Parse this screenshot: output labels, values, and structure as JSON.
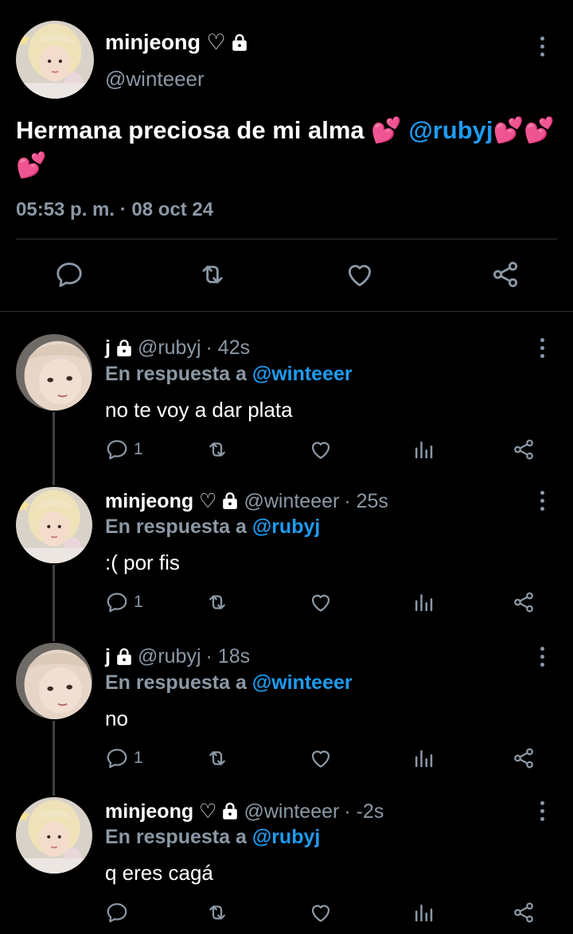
{
  "main_tweet": {
    "name": "minjeong ♡",
    "handle": "@winteeer",
    "text_prefix": "Hermana preciosa de mi alma 💕 ",
    "mention": "@rubyj",
    "text_suffix": "💕💕💕",
    "timestamp": "05:53 p. m. · 08 oct 24",
    "icons": [
      "reply-icon",
      "retweet-icon",
      "like-icon",
      "share-icon"
    ]
  },
  "replies": [
    {
      "name": "j",
      "handle": "@rubyj",
      "time": "· 42s",
      "in_reply_prefix": "En respuesta a ",
      "in_reply_to": "@winteeer",
      "text": "no te voy a dar plata",
      "reply_count": "1",
      "avatar": "rubyj"
    },
    {
      "name": "minjeong ♡",
      "handle": "@winteeer",
      "time": "· 25s",
      "in_reply_prefix": "En respuesta a ",
      "in_reply_to": "@rubyj",
      "text": ":( por fis",
      "reply_count": "1",
      "avatar": "winteeer"
    },
    {
      "name": "j",
      "handle": "@rubyj",
      "time": "· 18s",
      "in_reply_prefix": "En respuesta a ",
      "in_reply_to": "@winteeer",
      "text": "no",
      "reply_count": "1",
      "avatar": "rubyj"
    },
    {
      "name": "minjeong ♡",
      "handle": "@winteeer",
      "time": "· -2s",
      "in_reply_prefix": "En respuesta a ",
      "in_reply_to": "@rubyj",
      "text": "q eres cagá",
      "reply_count": "",
      "avatar": "winteeer"
    }
  ],
  "colors": {
    "background": "#000000",
    "text": "#ffffff",
    "muted": "#8b98a5",
    "accent": "#1d9bf0",
    "divider": "#2f3336"
  }
}
